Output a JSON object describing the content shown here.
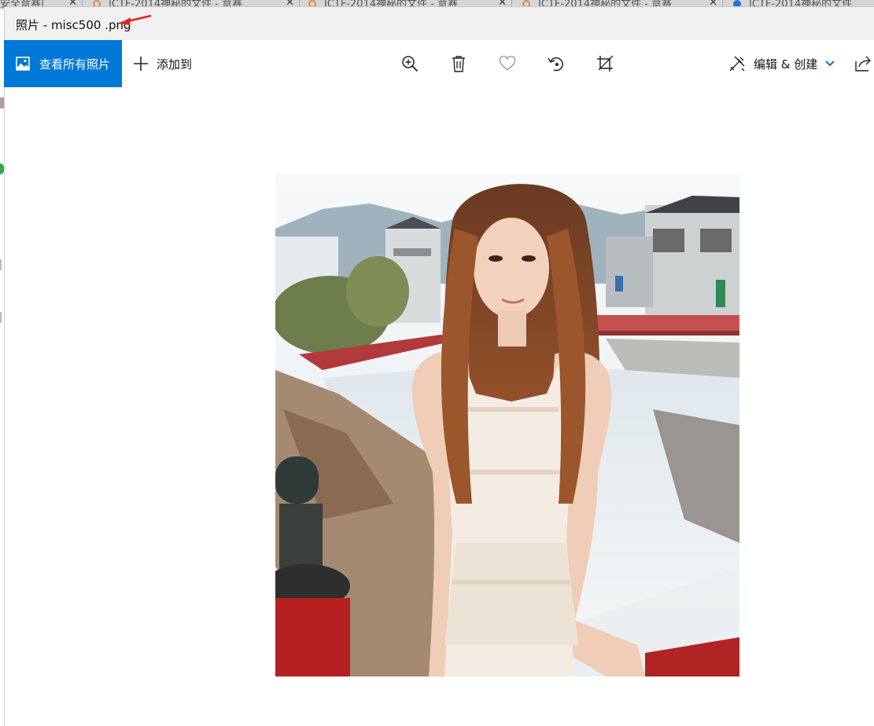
{
  "background_tabs": [
    {
      "label": "安全意赛|",
      "icon": "none-icon"
    },
    {
      "label": "ICTF-2014神秘的文件 - 意赛",
      "icon": "orange-logo-icon"
    },
    {
      "label": "ICTF-2014神秘的文件 - 意赛",
      "icon": "orange-logo-icon"
    },
    {
      "label": "ICTF-2014神秘的文件 - 意赛",
      "icon": "orange-logo-icon"
    },
    {
      "label": "ICTF-2014神秘的文件",
      "icon": "paw-icon"
    }
  ],
  "window": {
    "title": "照片 - misc500 .png"
  },
  "toolbar": {
    "view_all_label": "查看所有照片",
    "add_to_label": "添加到",
    "zoom_icon": "zoom-in-icon",
    "delete_icon": "trash-icon",
    "favorite_icon": "heart-icon",
    "rotate_icon": "rotate-icon",
    "crop_icon": "crop-icon",
    "edit_create_label": "编辑 & 创建",
    "share_icon": "share-icon"
  },
  "colors": {
    "accent": "#0078d7",
    "annotation_arrow": "#e8231a"
  }
}
